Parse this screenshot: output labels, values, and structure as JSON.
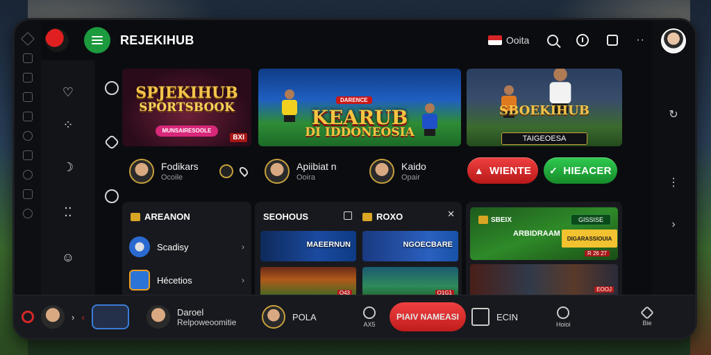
{
  "app": {
    "brand": "REJEKIHUB"
  },
  "topbar": {
    "lang_label": "Ooita",
    "more": "··"
  },
  "banners": {
    "b1": {
      "line1": "SPJEKIHUB",
      "line2": "SPORTSBOOK",
      "pill": "MUNSAIRESOOLE",
      "corner": "BXI"
    },
    "b2": {
      "tag": "DARENCE",
      "line1": "KEARUB",
      "line2": "DI IDDONEOSIA"
    },
    "b3": {
      "line1": "SBOEKIHUB",
      "sub": "TAIGEOESA"
    }
  },
  "profiles": [
    {
      "name": "Fodikars",
      "sub": "Ocoile"
    },
    {
      "name": "Apiibiat n",
      "sub": "Ooira"
    },
    {
      "name": "Kaido",
      "sub": "Opair"
    }
  ],
  "actions": {
    "red_label": "WIENTE",
    "green_label": "HIEACER"
  },
  "panel1": {
    "title": "AREANON",
    "items": [
      {
        "label": "Scadisy"
      },
      {
        "label": "Hécetios"
      }
    ]
  },
  "panel2": {
    "title_left": "SEOHOUS",
    "title_right": "ROXO",
    "cards": [
      {
        "label": "MAEERNUN"
      },
      {
        "label": "NGOECBARE"
      },
      {
        "tag": "Q43"
      },
      {
        "tag": "Q1G1"
      }
    ]
  },
  "panel3": {
    "header": "SBEIX",
    "badge": "GISSISE",
    "title": "ARBIDRAAM TE RIPRIHUK",
    "yellow": "DIGARASSIOUIA",
    "score": "R 26 27",
    "strip_tag": "EOOJ"
  },
  "bottombar": {
    "profile_name": "Daroel",
    "profile_sub": "Relpoweoomitie",
    "pola": "POLA",
    "search_label": "AX5",
    "play_label": "PIAIV NAMEASI",
    "sq_label": "ECIN",
    "clock_label": "Hoioi",
    "home_label": "Bie"
  },
  "colors": {
    "accent_green": "#1b9a3e",
    "accent_red": "#d62828",
    "gold": "#c9a13c"
  }
}
